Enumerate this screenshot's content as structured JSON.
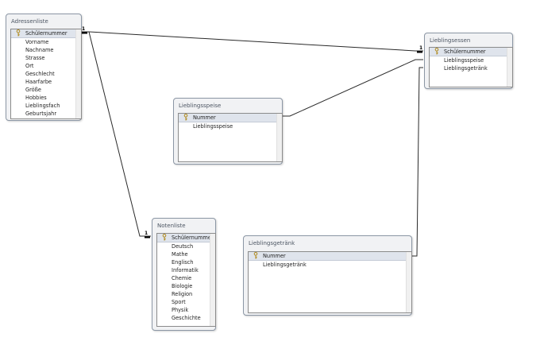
{
  "tables": {
    "adressenliste": {
      "title": "Adressenliste",
      "fields": [
        "Schülernummer",
        "Vorname",
        "Nachname",
        "Strasse",
        "Ort",
        "Geschlecht",
        "Haarfarbe",
        "Größe",
        "Hobbies",
        "Lieblingsfach",
        "Geburtsjahr"
      ]
    },
    "lieblingsessen": {
      "title": "Lieblingsessen",
      "fields": [
        "Schülernummer",
        "Lieblingsspeise",
        "Lieblingsgetränk"
      ]
    },
    "lieblingsspeise": {
      "title": "Lieblingsspeise",
      "fields": [
        "Nummer",
        "Lieblingsspeise"
      ]
    },
    "notenliste": {
      "title": "Notenliste",
      "fields": [
        "Schülernummer",
        "Deutsch",
        "Mathe",
        "Englisch",
        "Informatik",
        "Chemie",
        "Biologie",
        "Religion",
        "Sport",
        "Physik",
        "Geschichte"
      ]
    },
    "lieblingsgetraenk": {
      "title": "Lieblingsgetränk",
      "fields": [
        "Nummer",
        "Lieblingsgetränk"
      ]
    }
  },
  "relationships": {
    "cardinality_label": "1"
  },
  "icons": {
    "primary_key": "key-icon"
  },
  "colors": {
    "line": "#2a2a2a",
    "pk_row": "#dfe4ec",
    "frame": "#8c97a5",
    "title": "#4c5562"
  }
}
